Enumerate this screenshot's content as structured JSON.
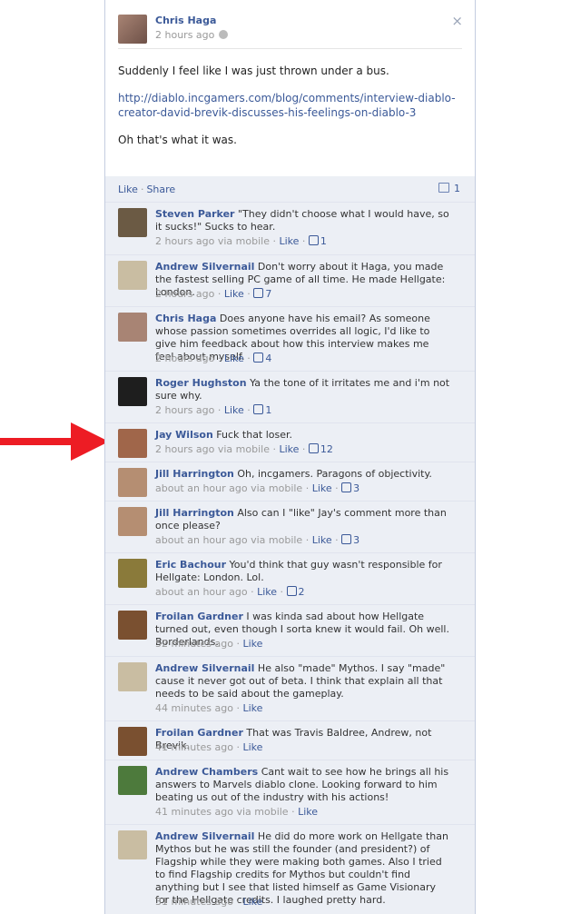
{
  "post": {
    "author": "Chris Haga",
    "time": "2 hours ago",
    "close_symbol": "×",
    "line1": "Suddenly I feel like I was just thrown under a bus.",
    "link": "http://diablo.incgamers.com/blog/comments/interview-diablo-creator-david-brevik-discusses-his-feelings-on-diablo-3",
    "line2": "Oh that's what it was."
  },
  "actions": {
    "like": "Like",
    "share": "Share",
    "comment_count": "1"
  },
  "comments": [
    {
      "name": "Steven Parker",
      "text": "\"They didn't choose what I would have, so it sucks!\" Sucks to hear.",
      "time": "2 hours ago via mobile",
      "like": "Like",
      "likes": "1",
      "avatar": "#6b5a44"
    },
    {
      "name": "Andrew Silvernail",
      "text": "Don't worry about it Haga, you made the fastest selling PC game of all time. He made Hellgate: London.",
      "time": "2 hours ago",
      "like": "Like",
      "likes": "7",
      "avatar": "#c9bda2"
    },
    {
      "name": "Chris Haga",
      "text": "Does anyone have his email? As someone whose passion sometimes overrides all logic, I'd like to give him feedback about how this interview makes me feel about myself.",
      "time": "2 hours ago",
      "like": "Like",
      "likes": "4",
      "avatar": "#a88474"
    },
    {
      "name": "Roger Hughston",
      "text": "Ya the tone of it irritates me and i'm not sure why.",
      "time": "2 hours ago",
      "like": "Like",
      "likes": "1",
      "avatar": "#1e1e1e"
    },
    {
      "name": "Jay Wilson",
      "text": "Fuck that loser.",
      "time": "2 hours ago via mobile",
      "like": "Like",
      "likes": "12",
      "avatar": "#a0664a"
    },
    {
      "name": "Jill Harrington",
      "text": "Oh, incgamers. Paragons of objectivity.",
      "time": "about an hour ago via mobile",
      "like": "Like",
      "likes": "3",
      "avatar": "#b58e72"
    },
    {
      "name": "Jill Harrington",
      "text": "Also can I \"like\" Jay's comment more than once please?",
      "time": "about an hour ago via mobile",
      "like": "Like",
      "likes": "3",
      "avatar": "#b58e72"
    },
    {
      "name": "Eric Bachour",
      "text": "You'd think that guy wasn't responsible for Hellgate: London. Lol.",
      "time": "about an hour ago",
      "like": "Like",
      "likes": "2",
      "avatar": "#8a7a3a"
    },
    {
      "name": "Froilan Gardner",
      "text": "I was kinda sad about how Hellgate turned out, even though I sorta knew it would fail. Oh well. Borderlands.",
      "time": "52 minutes ago",
      "like": "Like",
      "likes": "",
      "avatar": "#7a5030"
    },
    {
      "name": "Andrew Silvernail",
      "text": "He also \"made\" Mythos. I say \"made\" cause it never got out of beta. I think that explain all that needs to be said about the gameplay.",
      "time": "44 minutes ago",
      "like": "Like",
      "likes": "",
      "avatar": "#c9bda2"
    },
    {
      "name": "Froilan Gardner",
      "text": "That was Travis Baldree, Andrew, not Brevik.",
      "time": "41 minutes ago",
      "like": "Like",
      "likes": "",
      "avatar": "#7a5030"
    },
    {
      "name": "Andrew Chambers",
      "text": "Cant wait to see how he brings all his answers to Marvels diablo clone. Looking forward to him beating us out of the industry with his actions!",
      "time": "41 minutes ago via mobile",
      "like": "Like",
      "likes": "",
      "avatar": "#4d7a3c"
    },
    {
      "name": "Andrew Silvernail",
      "text": "He did do more work on Hellgate than Mythos but he was still the founder (and president?) of Flagship while they were making both games. Also I tried to find Flagship credits for Mythos but couldn't find anything but I see that listed himself as Game Visionary for the Hellgate credits. I laughed pretty hard.",
      "time": "31 minutes ago",
      "like": "Like",
      "likes": "",
      "avatar": "#c9bda2"
    }
  ]
}
